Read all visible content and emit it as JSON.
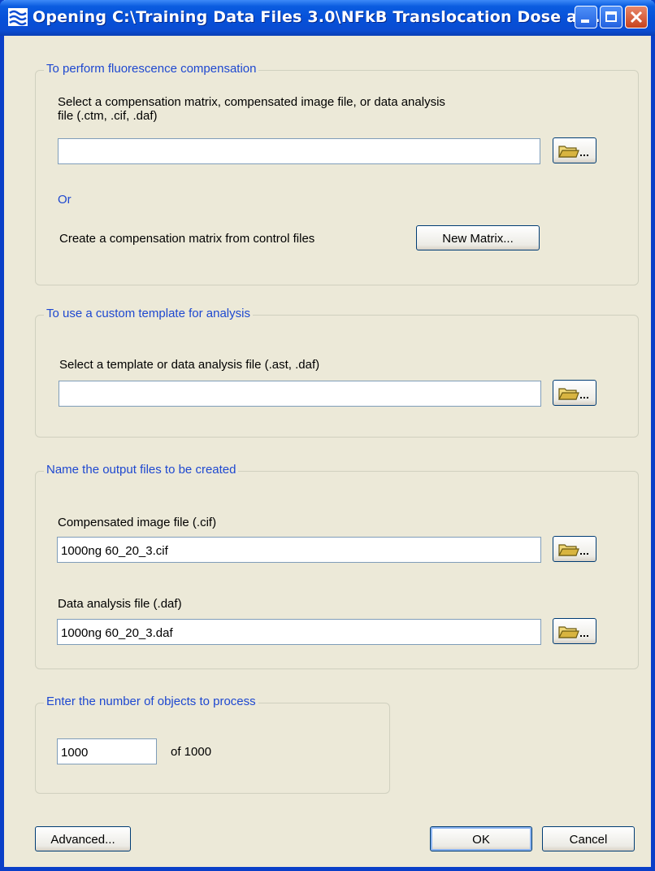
{
  "window": {
    "title": "Opening C:\\Training Data Files 3.0\\NFkB Translocation Dose an...",
    "titlebar_color": "#0a5ce0",
    "app_icon": "app-waves-icon"
  },
  "compensation": {
    "legend": "To perform fluorescence compensation",
    "select_label": "Select a compensation matrix, compensated image file, or data analysis file (.ctm, .cif, .daf)",
    "file_value": "",
    "or_label": "Or",
    "create_label": "Create a compensation matrix from control files",
    "new_matrix_label": "New Matrix..."
  },
  "template": {
    "legend": "To use a custom template for analysis",
    "select_label": "Select a template or data analysis file (.ast, .daf)",
    "file_value": ""
  },
  "output": {
    "legend": "Name the output files to be created",
    "cif_label": "Compensated image file (.cif)",
    "cif_value": "1000ng 60_20_3.cif",
    "daf_label": "Data analysis file (.daf)",
    "daf_value": "1000ng 60_20_3.daf"
  },
  "objects": {
    "legend": "Enter the number of objects to process",
    "count_value": "1000",
    "of_label": "of 1000"
  },
  "buttons": {
    "advanced_label": "Advanced...",
    "ok_label": "OK",
    "cancel_label": "Cancel"
  },
  "icons": {
    "browse": "folder-browse-icon",
    "minimize": "minimize-icon",
    "maximize": "maximize-icon",
    "close": "close-icon"
  },
  "colors": {
    "dialog_bg": "#ece9d8",
    "legend_text": "#1e48d0",
    "close_button": "#c8431e"
  }
}
